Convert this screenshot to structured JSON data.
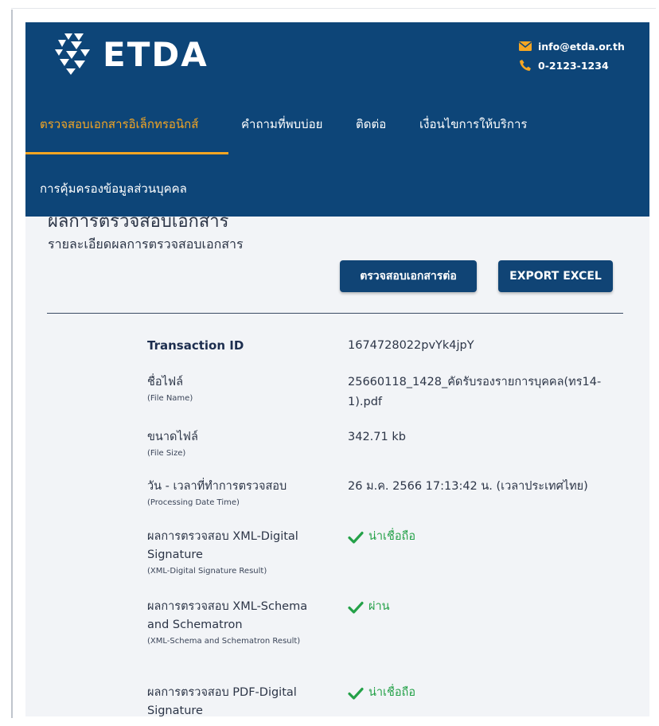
{
  "header": {
    "logo_text": "ETDA",
    "email": "info@etda.or.th",
    "phone": "0-2123-1234",
    "nav": [
      "ตรวจสอบเอกสารอิเล็กทรอนิกส์",
      "คำถามที่พบบ่อย",
      "ติดต่อ",
      "เงื่อนไขการให้บริการ",
      "การคุ้มครองข้อมูลส่วนบุคคล"
    ]
  },
  "page": {
    "heading": "ผลการตรวจสอบเอกสาร",
    "subtitle": "รายละเอียดผลการตรวจสอบเอกสาร",
    "verify_more_button": "ตรวจสอบเอกสารต่อ",
    "export_button": "EXPORT EXCEL"
  },
  "results": {
    "transaction": {
      "label": "Transaction ID",
      "value": "1674728022pvYk4jpY"
    },
    "file_name": {
      "label": "ชื่อไฟล์",
      "label_en": "(File Name)",
      "value": "25660118_1428_คัดรับรองรายการบุคคล(ทร14-1).pdf"
    },
    "file_size": {
      "label": "ขนาดไฟล์",
      "label_en": "(File Size)",
      "value": "342.71 kb"
    },
    "processing_time": {
      "label": "วัน - เวลาที่ทำการตรวจสอบ",
      "label_en": "(Processing Date Time)",
      "value": "26 ม.ค. 2566 17:13:42 น. (เวลาประเทศไทย)"
    },
    "xml_signature": {
      "label": "ผลการตรวจสอบ XML-Digital Signature",
      "label_en": "(XML-Digital Signature Result)",
      "value": "น่าเชื่อถือ"
    },
    "xml_schema": {
      "label": "ผลการตรวจสอบ XML-Schema and Schematron",
      "label_en": "(XML-Schema and Schematron Result)",
      "value": "ผ่าน"
    },
    "pdf_signature": {
      "label": "ผลการตรวจสอบ PDF-Digital Signature",
      "value": "น่าเชื่อถือ"
    }
  },
  "colors": {
    "header_bg": "#0d4578",
    "accent": "#f5a623",
    "success": "#24a148",
    "button_bg": "#104475"
  }
}
